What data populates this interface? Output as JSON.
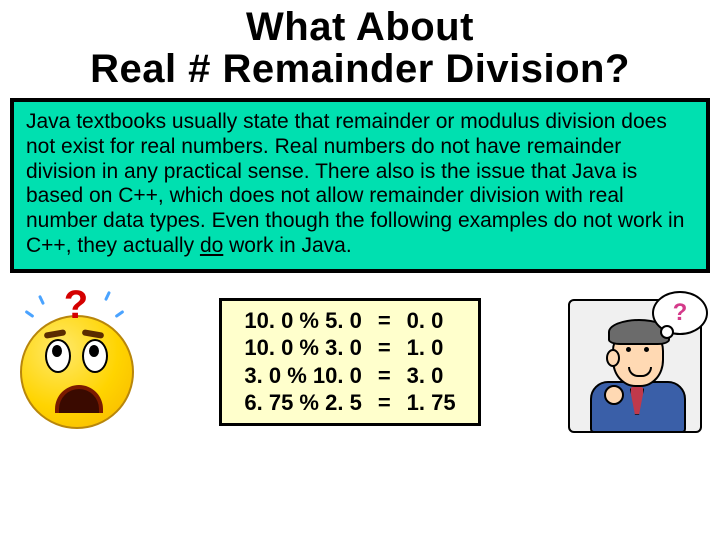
{
  "title_line1": "What About",
  "title_line2": "Real # Remainder Division?",
  "explanation_pre": "Java textbooks usually state that remainder or modulus division does not exist for real numbers.  Real numbers do not have remainder division in any practical sense.  There also is the issue that Java is based on C++, which does not allow remainder division with real number data types.  Even though the following examples do not work in C++, they actually ",
  "explanation_underlined": "do",
  "explanation_post": " work in Java.",
  "examples": [
    {
      "expr": "10. 0 % 5. 0",
      "eq": "=",
      "result": "0. 0"
    },
    {
      "expr": "10. 0 % 3. 0",
      "eq": "=",
      "result": "1. 0"
    },
    {
      "expr": "3. 0 % 10. 0",
      "eq": "=",
      "result": "3. 0"
    },
    {
      "expr": "6. 75 % 2. 5",
      "eq": "=",
      "result": "1. 75"
    }
  ],
  "qmark": "?",
  "bubble_text": "?"
}
